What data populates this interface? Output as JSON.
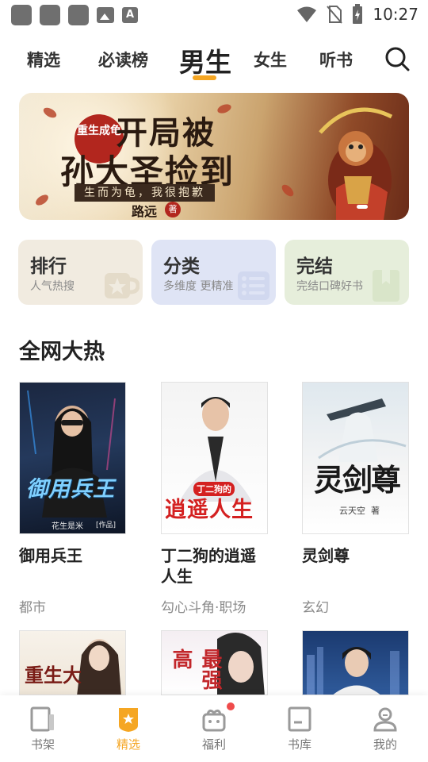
{
  "status_bar": {
    "time": "10:27",
    "icons": [
      "notification-square-icon",
      "notification-square-icon",
      "notification-square-icon",
      "image-icon",
      "font-icon",
      "wifi-icon",
      "no-sim-icon",
      "battery-charging-icon"
    ]
  },
  "tabs": [
    {
      "label": "精选",
      "active": false
    },
    {
      "label": "必读榜",
      "active": false
    },
    {
      "label": "男生",
      "active": true
    },
    {
      "label": "女生",
      "active": false
    },
    {
      "label": "听书",
      "active": false
    }
  ],
  "search": {
    "icon": "search-icon"
  },
  "banner": {
    "seal": "重生成龟",
    "title_line1": "开局被",
    "title_line2": "孙大圣捡到",
    "tagline": "生而为龟，我很抱歉",
    "author": "路远",
    "author_mark": "著"
  },
  "categories": [
    {
      "title": "排行",
      "subtitle": "人气热搜",
      "color": "#f1ebe0",
      "icon": "cup-icon"
    },
    {
      "title": "分类",
      "subtitle": "多维度 更精准",
      "color": "#dfe4f5",
      "icon": "list-icon"
    },
    {
      "title": "完结",
      "subtitle": "完结口碑好书",
      "color": "#e6eedb",
      "icon": "bookmark-icon"
    }
  ],
  "section": {
    "title": "全网大热"
  },
  "books": [
    {
      "title": "御用兵王",
      "genre": "都市",
      "cover_text": "御用兵王",
      "cover_author": "花生是米",
      "cover_note": "[作品]"
    },
    {
      "title": "丁二狗的逍遥人生",
      "genre": "勾心斗角·职场",
      "cover_text": "逍遥人生",
      "cover_small": "丁二狗的"
    },
    {
      "title": "灵剑尊",
      "genre": "玄幻",
      "cover_text": "灵剑尊",
      "cover_author": "云天空",
      "cover_note": "著"
    }
  ],
  "books_row2": [
    {
      "cover_text": "重生大"
    },
    {
      "cover_text": "最强高"
    },
    {
      "cover_text": ""
    }
  ],
  "bottom_nav": [
    {
      "label": "书架",
      "icon": "bookshelf-icon",
      "active": false
    },
    {
      "label": "精选",
      "icon": "featured-star-icon",
      "active": true
    },
    {
      "label": "福利",
      "icon": "gift-icon",
      "active": false,
      "badge": true
    },
    {
      "label": "书库",
      "icon": "library-icon",
      "active": false
    },
    {
      "label": "我的",
      "icon": "profile-icon",
      "active": false
    }
  ],
  "colors": {
    "accent": "#f5a623",
    "badge": "#ef4b4b"
  }
}
